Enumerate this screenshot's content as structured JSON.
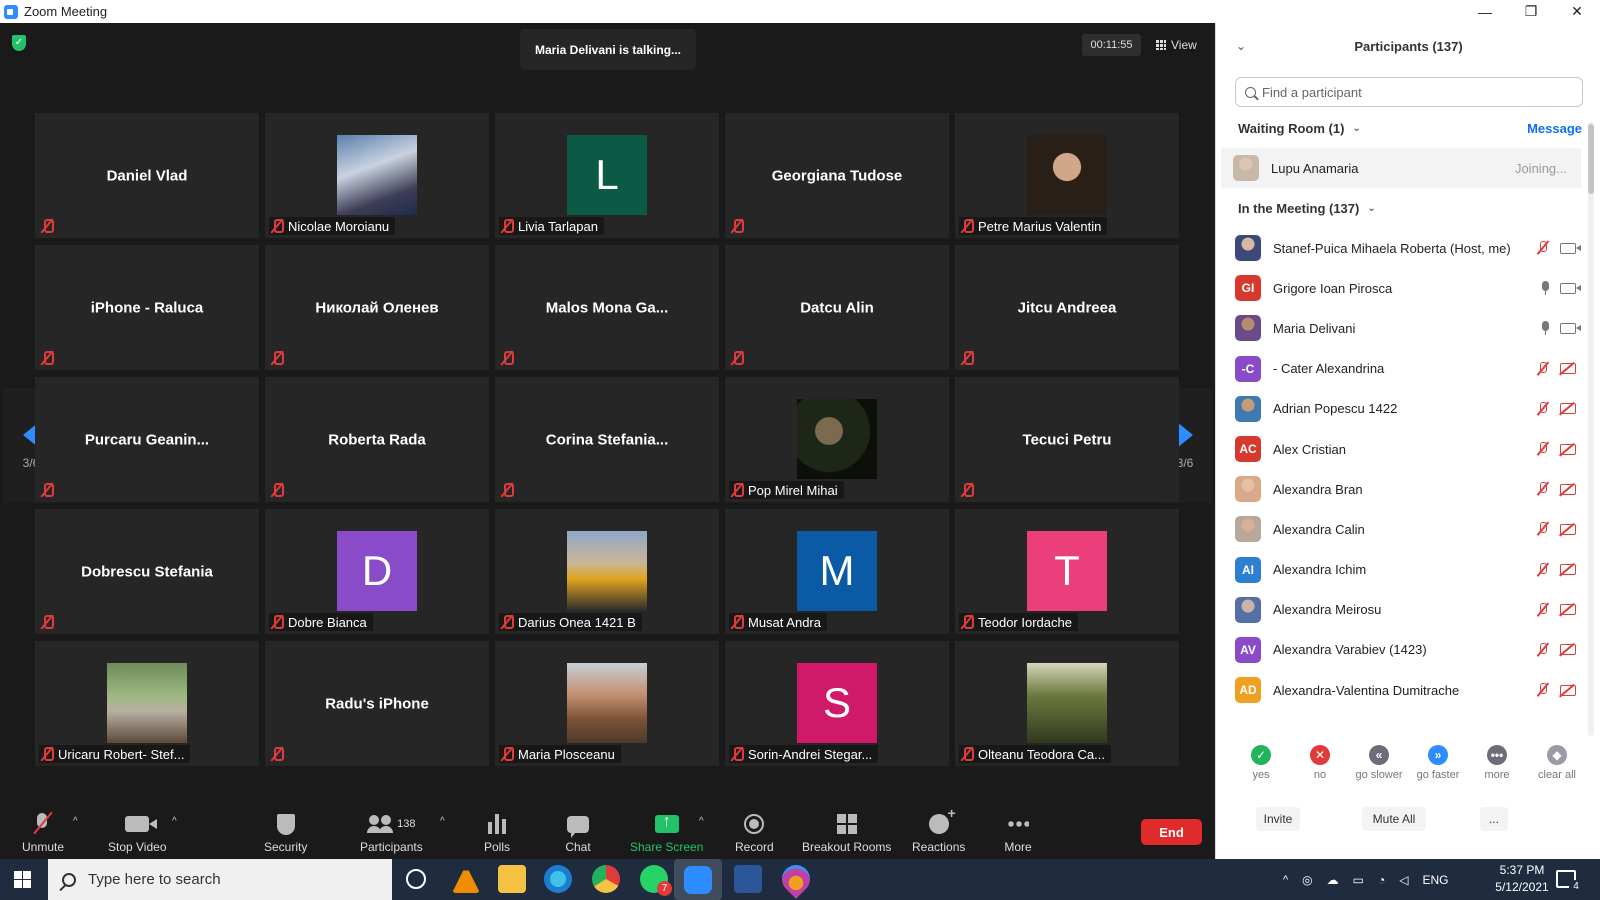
{
  "window": {
    "title": "Zoom Meeting",
    "controls": [
      "—",
      "❐",
      "✕"
    ]
  },
  "meeting": {
    "talking": "Maria Delivani is talking...",
    "timer": "00:11:55",
    "view_label": "View",
    "page_left": "3/6",
    "page_right": "3/6"
  },
  "tiles": [
    {
      "type": "name",
      "name": "Daniel Vlad"
    },
    {
      "type": "photo",
      "name": "Nicolae Moroianu",
      "photo": "ph-a"
    },
    {
      "type": "letter",
      "name": "Livia Tarlapan",
      "letter": "L",
      "color": "#0b5a46"
    },
    {
      "type": "name",
      "name": "Georgiana Tudose"
    },
    {
      "type": "photo",
      "name": "Petre Marius Valentin",
      "photo": "ph-b"
    },
    {
      "type": "name",
      "name": "iPhone - Raluca"
    },
    {
      "type": "name",
      "name": "Николай Оленев"
    },
    {
      "type": "name",
      "name": "Malos  Mona  Ga..."
    },
    {
      "type": "name",
      "name": "Datcu Alin"
    },
    {
      "type": "name",
      "name": "Jitcu Andreea"
    },
    {
      "type": "name",
      "name": "Purcaru  Geanin..."
    },
    {
      "type": "name",
      "name": "Roberta Rada"
    },
    {
      "type": "name",
      "name": "Corina  Stefania..."
    },
    {
      "type": "photo",
      "name": "Pop Mirel Mihai",
      "photo": "ph-c"
    },
    {
      "type": "name",
      "name": "Tecuci Petru"
    },
    {
      "type": "name",
      "name": "Dobrescu Stefania"
    },
    {
      "type": "letter",
      "name": "Dobre Bianca",
      "letter": "D",
      "color": "#8a4bc9"
    },
    {
      "type": "photo",
      "name": "Darius Onea 1421 B",
      "photo": "ph-d"
    },
    {
      "type": "letter",
      "name": "Musat Andra",
      "letter": "M",
      "color": "#0a5aa6"
    },
    {
      "type": "letter",
      "name": "Teodor Iordache",
      "letter": "T",
      "color": "#ea3f7a"
    },
    {
      "type": "photo",
      "name": "Uricaru Robert- Stef...",
      "photo": "ph-e"
    },
    {
      "type": "name",
      "name": "Radu's iPhone"
    },
    {
      "type": "photo",
      "name": "Maria Plosceanu",
      "photo": "ph-f"
    },
    {
      "type": "letter",
      "name": "Sorin-Andrei Stegar...",
      "letter": "S",
      "color": "#d1196a"
    },
    {
      "type": "photo",
      "name": "Olteanu Teodora Ca...",
      "photo": "ph-g"
    }
  ],
  "toolbar": {
    "unmute": "Unmute",
    "stop_video": "Stop Video",
    "security": "Security",
    "participants": "Participants",
    "participants_count": "138",
    "polls": "Polls",
    "chat": "Chat",
    "share_screen": "Share Screen",
    "record": "Record",
    "breakout": "Breakout Rooms",
    "reactions": "Reactions",
    "more": "More",
    "end": "End",
    "caret": "^"
  },
  "panel": {
    "title": "Participants (137)",
    "collapse": "⌄",
    "search_placeholder": "Find a participant",
    "waiting_label": "Waiting Room (1)",
    "message_link": "Message",
    "waiting": {
      "name": "Lupu Anamaria",
      "status": "Joining..."
    },
    "in_meeting_label": "In the Meeting (137)",
    "participants": [
      {
        "name": "Stanef-Puica Mihaela Roberta (Host, me)",
        "avatar": "photo1",
        "initials": "",
        "mic": "off",
        "cam": "on"
      },
      {
        "name": "Grigore Ioan Pirosca",
        "avatar": "initials",
        "initials": "GI",
        "color": "#d63a2f",
        "mic": "on",
        "cam": "on"
      },
      {
        "name": "Maria Delivani",
        "avatar": "photo2",
        "initials": "",
        "mic": "on",
        "cam": "on"
      },
      {
        "name": "- Cater Alexandrina",
        "avatar": "initials",
        "initials": "-C",
        "color": "#8a4bc9",
        "mic": "off",
        "cam": "off"
      },
      {
        "name": "Adrian Popescu 1422",
        "avatar": "photo3",
        "initials": "",
        "mic": "off",
        "cam": "off"
      },
      {
        "name": "Alex Cristian",
        "avatar": "initials",
        "initials": "AC",
        "color": "#d63a2f",
        "mic": "off",
        "cam": "off"
      },
      {
        "name": "Alexandra Bran",
        "avatar": "photo4",
        "initials": "",
        "mic": "off",
        "cam": "off"
      },
      {
        "name": "Alexandra Calin",
        "avatar": "photo5",
        "initials": "",
        "mic": "off",
        "cam": "off"
      },
      {
        "name": "Alexandra Ichim",
        "avatar": "initials",
        "initials": "AI",
        "color": "#2d7fd0",
        "mic": "off",
        "cam": "off"
      },
      {
        "name": "Alexandra Meirosu",
        "avatar": "photo6",
        "initials": "",
        "mic": "off",
        "cam": "off"
      },
      {
        "name": "Alexandra Varabiev (1423)",
        "avatar": "initials",
        "initials": "AV",
        "color": "#8a4bc9",
        "mic": "off",
        "cam": "off"
      },
      {
        "name": "Alexandra-Valentina Dumitrache",
        "avatar": "initials",
        "initials": "AD",
        "color": "#f0a020",
        "mic": "off",
        "cam": "off"
      }
    ],
    "feedback": [
      {
        "label": "yes",
        "glyph": "✓",
        "color": "#23b35a"
      },
      {
        "label": "no",
        "glyph": "✕",
        "color": "#e03b3b"
      },
      {
        "label": "go slower",
        "glyph": "«",
        "color": "#6c6c7a"
      },
      {
        "label": "go faster",
        "glyph": "»",
        "color": "#2d8cff"
      },
      {
        "label": "more",
        "glyph": "•••",
        "color": "#6c6c7a"
      },
      {
        "label": "clear all",
        "glyph": "◆",
        "color": "#9a9aa8"
      }
    ],
    "invite": "Invite",
    "mute_all": "Mute All",
    "more_btn": "..."
  },
  "taskbar": {
    "search_placeholder": "Type here to search",
    "whatsapp_badge": "7",
    "lang": "ENG",
    "time": "5:37 PM",
    "date": "5/12/2021",
    "notif": "4"
  },
  "colors": {
    "accent": "#2d8cff",
    "end": "#e02b2b",
    "share": "#23c26a",
    "mute": "#e03b3b"
  }
}
